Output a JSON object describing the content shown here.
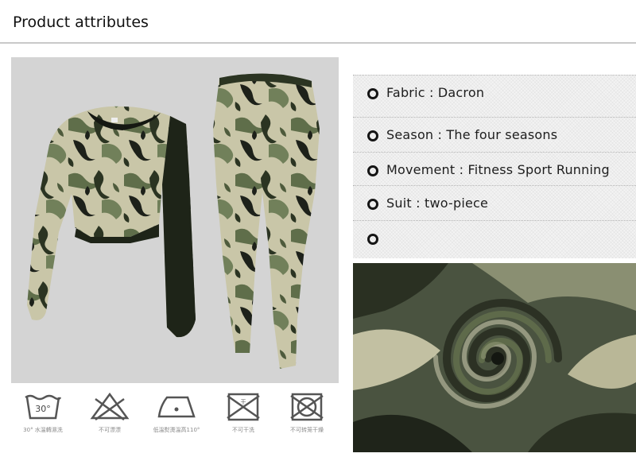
{
  "header": {
    "title": "Product attributes"
  },
  "product_image": {
    "alt": "camouflage crop top and leggings",
    "colors": [
      "#2f3a26",
      "#6b7a55",
      "#c9c7ad",
      "#1c1f18"
    ]
  },
  "care_instructions": [
    {
      "icon": "wash-30-icon",
      "symbol": "30°",
      "caption": "30° 水溫轉濕洗"
    },
    {
      "icon": "no-bleach-icon",
      "symbol": "",
      "caption": "不可漂漂"
    },
    {
      "icon": "iron-low-icon",
      "symbol": "",
      "caption": "低溫熨燙溫高110°"
    },
    {
      "icon": "no-dry-clean-icon",
      "symbol": "干",
      "caption": "不可干洗"
    },
    {
      "icon": "no-tumble-dry-icon",
      "symbol": "",
      "caption": "不可转笼干燥"
    }
  ],
  "attributes": [
    {
      "text": "Fabric : Dacron"
    },
    {
      "text": "Season : The four seasons"
    },
    {
      "text": "Movement : Fitness Sport Running"
    },
    {
      "text": "Suit : two-piece"
    },
    {
      "text": ""
    }
  ],
  "fabric_image": {
    "alt": "camouflage fabric close-up"
  }
}
